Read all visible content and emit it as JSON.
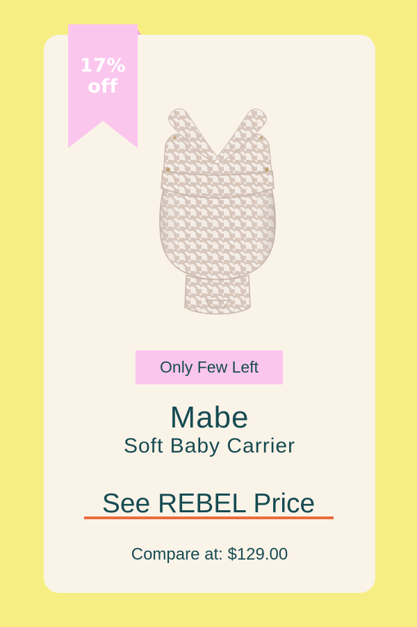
{
  "promo": {
    "discount_label": "17%\noff"
  },
  "product": {
    "stock_badge": "Only Few Left",
    "brand": "Mabe",
    "name": "Soft Baby Carrier",
    "cta_label": "See REBEL Price",
    "compare_price": "Compare at: $129.00",
    "image_icon": "soft-baby-carrier-image"
  },
  "colors": {
    "background": "#f7ee83",
    "card": "#faf3e8",
    "accent_pink": "#fbc6ee",
    "text_teal": "#164b52",
    "underline_orange": "#ea6c3b"
  }
}
